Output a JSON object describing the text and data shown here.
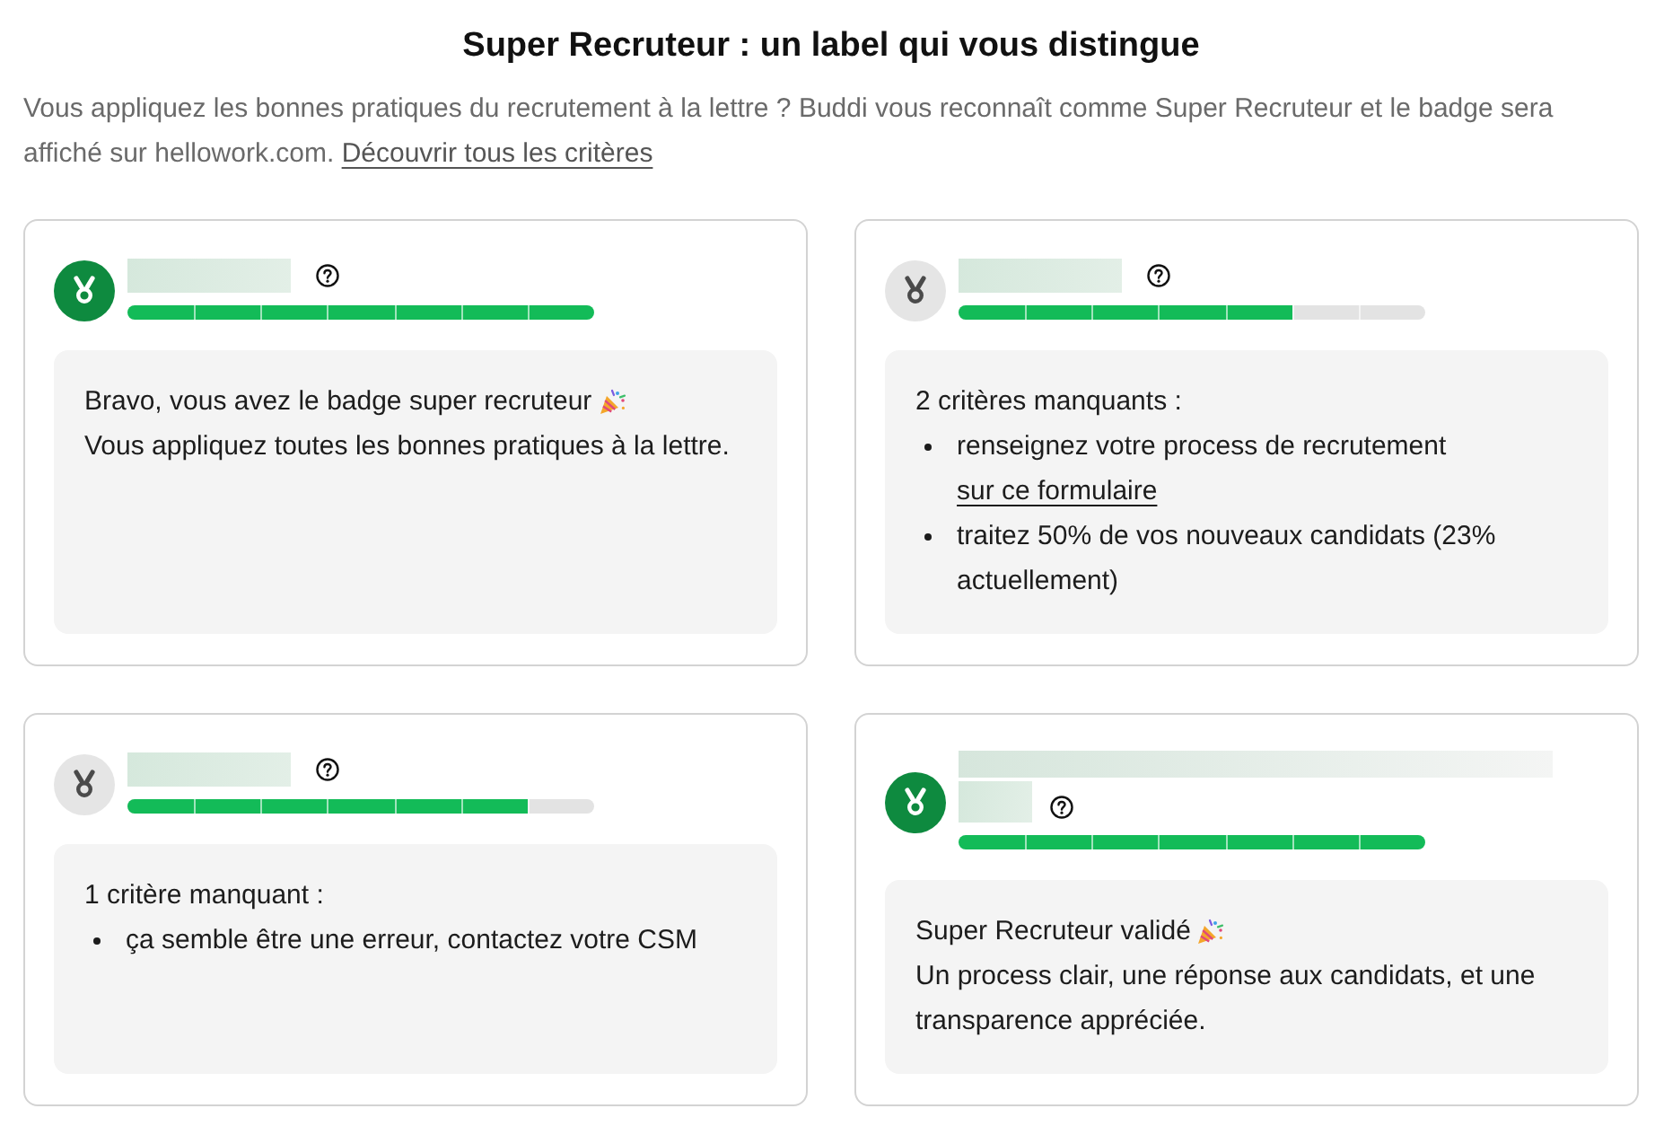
{
  "header": {
    "title": "Super Recruteur : un label qui vous distingue",
    "description": "Vous appliquez les bonnes pratiques du recrutement à la lettre ? Buddi vous reconnaît comme Super Recruteur et le badge sera affiché sur hellowork.com.",
    "link": "Découvrir tous les critères"
  },
  "cards": [
    {
      "badge_earned": true,
      "name_wraps": false,
      "level": 1,
      "message": {
        "kind": "success",
        "title": "Bravo, vous avez le badge super recruteur",
        "text": "Vous appliquez toutes les bonnes pratiques à la lettre."
      }
    },
    {
      "badge_earned": false,
      "name_wraps": false,
      "level": 0.714,
      "message": {
        "kind": "missing",
        "title": "2 critères manquants :",
        "items": [
          {
            "text": "renseignez votre process de recrutement",
            "link": "sur ce formulaire"
          },
          {
            "text": "traitez 50% de vos nouveaux candidats (23% actuellement)"
          }
        ]
      }
    },
    {
      "badge_earned": false,
      "name_wraps": false,
      "level": 0.857,
      "message": {
        "kind": "missing",
        "title": "1 critère manquant :",
        "items": [
          {
            "text": "ça semble être une erreur, contactez votre CSM"
          }
        ]
      }
    },
    {
      "badge_earned": true,
      "name_wraps": true,
      "level": 1,
      "message": {
        "kind": "success",
        "title": "Super Recruteur validé",
        "text": "Un process clair, une réponse aux candidats, et une transparence appréciée."
      }
    }
  ]
}
